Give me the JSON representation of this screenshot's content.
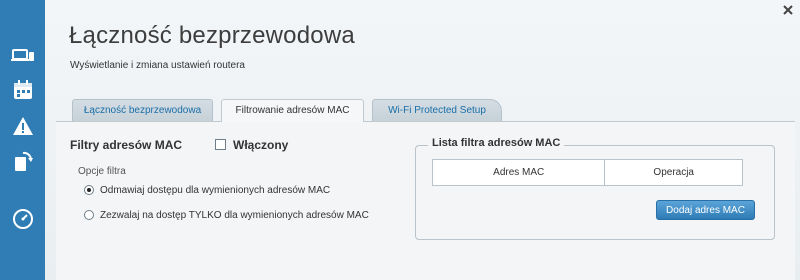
{
  "header": {
    "title": "Łączność bezprzewodowa",
    "subtitle": "Wyświetlanie i zmiana ustawień routera"
  },
  "sidebar": {
    "icons": [
      "devices-icon",
      "calendar-icon",
      "alert-icon",
      "update-icon",
      "speed-icon"
    ]
  },
  "tabs": [
    {
      "label": "Łączność bezprzewodowa",
      "active": false
    },
    {
      "label": "Filtrowanie adresów MAC",
      "active": true
    },
    {
      "label": "Wi-Fi Protected Setup",
      "active": false
    }
  ],
  "filters": {
    "heading": "Filtry adresów MAC",
    "enable_label": "Włączony",
    "enabled": false,
    "options_label": "Opcje filtra",
    "options": [
      {
        "label": "Odmawiaj dostępu dla wymienionych adresów MAC",
        "selected": true
      },
      {
        "label": "Zezwalaj na dostęp TYLKO dla wymienionych adresów MAC",
        "selected": false
      }
    ]
  },
  "mac_list": {
    "legend": "Lista filtra adresów MAC",
    "columns": [
      "Adres MAC",
      "Operacja"
    ],
    "rows": [],
    "add_button": "Dodaj adres MAC"
  },
  "colors": {
    "sidebar": "#2f7db4",
    "link": "#1a6ea8",
    "button": "#2e7bb6"
  }
}
